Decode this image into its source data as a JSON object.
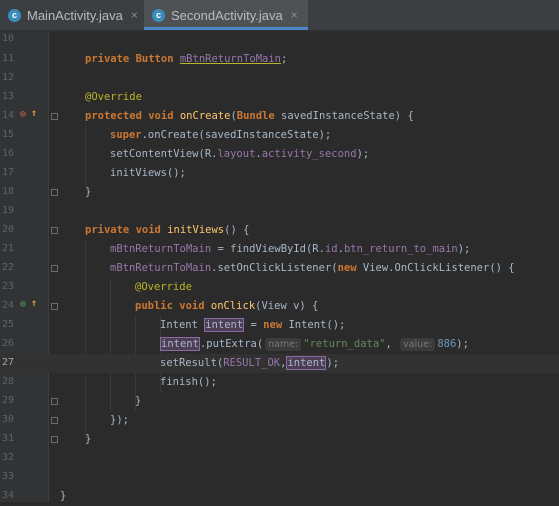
{
  "tabs": [
    {
      "icon": "c-class-icon",
      "icon_text": "c",
      "label": "MainActivity.java",
      "close": "×",
      "active": false
    },
    {
      "icon": "c-class-icon",
      "icon_text": "c",
      "label": "SecondActivity.java",
      "close": "×",
      "active": true
    }
  ],
  "lines": [
    {
      "num": "10",
      "text": ""
    },
    {
      "num": "11",
      "text": "    private Button mBtnReturnToMain;"
    },
    {
      "num": "12",
      "text": ""
    },
    {
      "num": "13",
      "text": "    @Override"
    },
    {
      "num": "14",
      "text": "    protected void onCreate(Bundle savedInstanceState) {"
    },
    {
      "num": "15",
      "text": "        super.onCreate(savedInstanceState);"
    },
    {
      "num": "16",
      "text": "        setContentView(R.layout.activity_second);"
    },
    {
      "num": "17",
      "text": "        initViews();"
    },
    {
      "num": "18",
      "text": "    }"
    },
    {
      "num": "19",
      "text": ""
    },
    {
      "num": "20",
      "text": "    private void initViews() {"
    },
    {
      "num": "21",
      "text": "        mBtnReturnToMain = findViewById(R.id.btn_return_to_main);"
    },
    {
      "num": "22",
      "text": "        mBtnReturnToMain.setOnClickListener(new View.OnClickListener() {"
    },
    {
      "num": "23",
      "text": "            @Override"
    },
    {
      "num": "24",
      "text": "            public void onClick(View v) {"
    },
    {
      "num": "25",
      "text": "                Intent intent = new Intent();"
    },
    {
      "num": "26",
      "text": "                intent.putExtra( name: \"return_data\", value: 886);"
    },
    {
      "num": "27",
      "text": "                setResult(RESULT_OK,intent);"
    },
    {
      "num": "28",
      "text": "                finish();"
    },
    {
      "num": "29",
      "text": "            }"
    },
    {
      "num": "30",
      "text": "        });"
    },
    {
      "num": "31",
      "text": "    }"
    },
    {
      "num": "32",
      "text": ""
    },
    {
      "num": "33",
      "text": ""
    },
    {
      "num": "34",
      "text": "}"
    }
  ],
  "param_hints": {
    "name": "name:",
    "value": "value:"
  },
  "gutter_icons": {
    "line14": "override-up-arrow-icon",
    "line24": "implement-up-arrow-icon"
  },
  "current_line": "27",
  "colors": {
    "editor_bg": "#2B2B2B",
    "gutter_bg": "#313335",
    "tabbar_bg": "#3C3F41",
    "keyword": "#CC7832",
    "annotation": "#BBB529",
    "method": "#FFC66D",
    "field": "#9876AA",
    "string": "#6A8759",
    "number": "#6897BB",
    "text": "#A9B7C6"
  }
}
